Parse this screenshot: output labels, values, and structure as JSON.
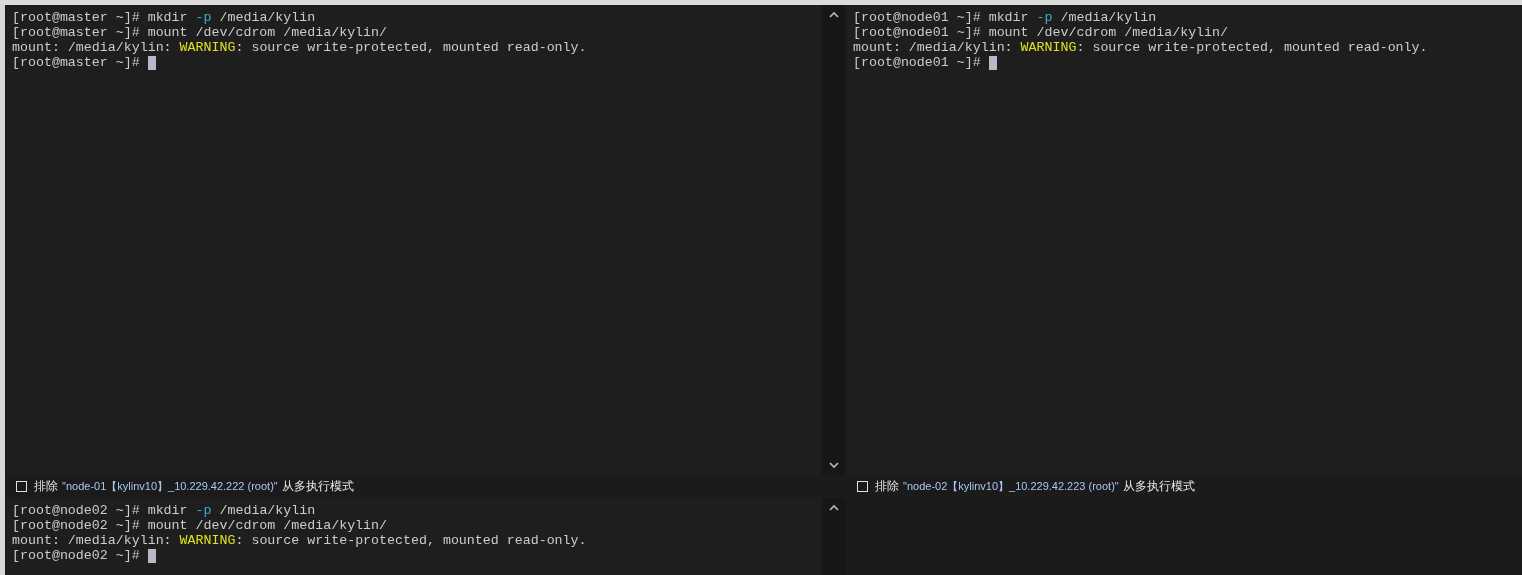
{
  "panes": [
    {
      "scrollbar": true,
      "cursor": true,
      "lines": [
        [
          {
            "text": "[root@master ~]# mkdir ",
            "kind": "plain"
          },
          {
            "text": "-p",
            "kind": "option"
          },
          {
            "text": " /media/kylin",
            "kind": "plain"
          }
        ],
        [
          {
            "text": "[root@master ~]# mount /dev/cdrom /media/kylin/",
            "kind": "plain"
          }
        ],
        [
          {
            "text": "mount: /media/kylin: ",
            "kind": "plain"
          },
          {
            "text": "WARNING",
            "kind": "warning"
          },
          {
            "text": ": source write-protected, mounted read-only.",
            "kind": "plain"
          }
        ],
        [
          {
            "text": "[root@master ~]# ",
            "kind": "plain"
          }
        ]
      ],
      "exclude": {
        "checked": false,
        "label": "排除",
        "target": "\"node-01【kylinv10】_10.229.42.222 (root)\"",
        "suffix": "从多执行模式"
      }
    },
    {
      "scrollbar": false,
      "cursor": true,
      "lines": [
        [
          {
            "text": "[root@node01 ~]# mkdir ",
            "kind": "plain"
          },
          {
            "text": "-p",
            "kind": "option"
          },
          {
            "text": " /media/kylin",
            "kind": "plain"
          }
        ],
        [
          {
            "text": "[root@node01 ~]# mount /dev/cdrom /media/kylin/",
            "kind": "plain"
          }
        ],
        [
          {
            "text": "mount: /media/kylin: ",
            "kind": "plain"
          },
          {
            "text": "WARNING",
            "kind": "warning"
          },
          {
            "text": ": source write-protected, mounted read-only.",
            "kind": "plain"
          }
        ],
        [
          {
            "text": "[root@node01 ~]# ",
            "kind": "plain"
          }
        ]
      ],
      "exclude": {
        "checked": false,
        "label": "排除",
        "target": "\"node-02【kylinv10】_10.229.42.223 (root)\"",
        "suffix": "从多执行模式"
      }
    },
    {
      "scrollbar": true,
      "cursor": true,
      "lines": [
        [
          {
            "text": "[root@node02 ~]# mkdir ",
            "kind": "plain"
          },
          {
            "text": "-p",
            "kind": "option"
          },
          {
            "text": " /media/kylin",
            "kind": "plain"
          }
        ],
        [
          {
            "text": "[root@node02 ~]# mount /dev/cdrom /media/kylin/",
            "kind": "plain"
          }
        ],
        [
          {
            "text": "mount: /media/kylin: ",
            "kind": "plain"
          },
          {
            "text": "WARNING",
            "kind": "warning"
          },
          {
            "text": ": source write-protected, mounted read-only.",
            "kind": "plain"
          }
        ],
        [
          {
            "text": "[root@node02 ~]# ",
            "kind": "plain"
          }
        ]
      ]
    }
  ]
}
